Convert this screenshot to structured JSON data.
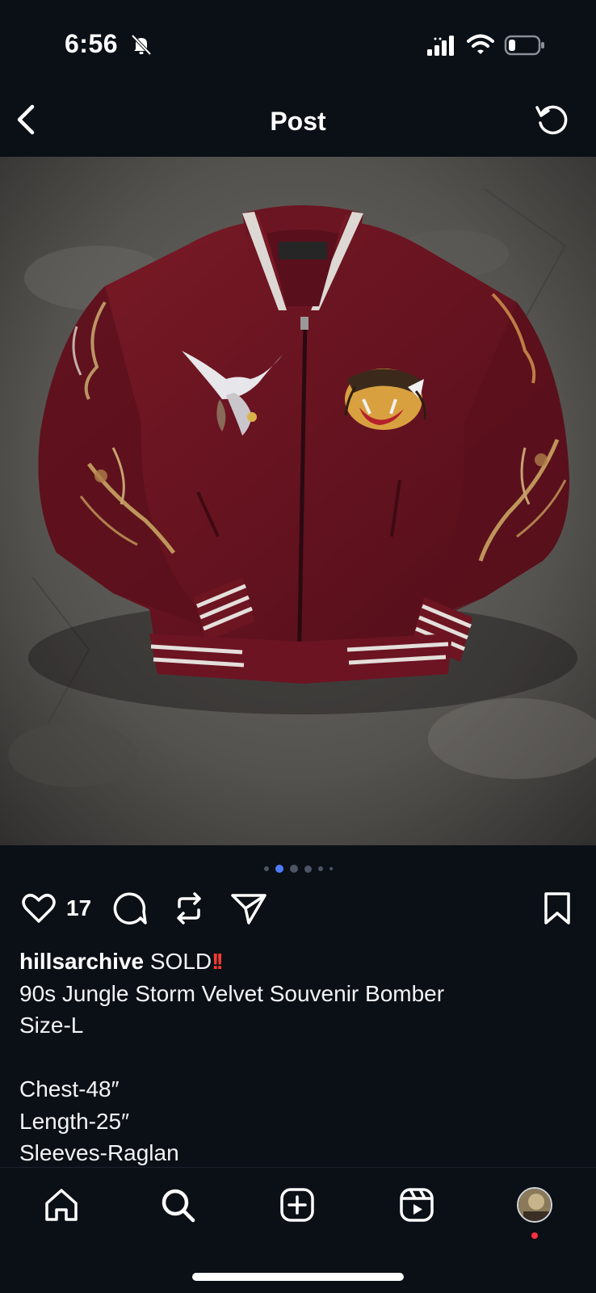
{
  "status_bar": {
    "time": "6:56",
    "icons": [
      "bell-slash-icon",
      "signal-icon",
      "wifi-icon",
      "battery-icon"
    ]
  },
  "header": {
    "title": "Post",
    "back_icon": "chevron-left-icon",
    "refresh_icon": "refresh-icon"
  },
  "post": {
    "image_count": 6,
    "current_image": 2,
    "likes": "17",
    "action_icons": [
      "heart-icon",
      "comment-icon",
      "repost-icon",
      "share-icon",
      "bookmark-icon"
    ],
    "username": "hillsarchive",
    "caption_status": "SOLD",
    "caption_mark": "!!",
    "caption_lines": [
      "90s Jungle Storm Velvet Souvenir Bomber",
      "Size-L",
      "",
      "Chest-48″",
      "Length-25″",
      "Sleeves-Raglan"
    ]
  },
  "bottom_nav": {
    "items": [
      "home-icon",
      "search-icon",
      "create-icon",
      "reels-icon",
      "profile-avatar"
    ]
  },
  "colors": {
    "background": "#0b0f16",
    "text": "#ffffff",
    "accent_dot": "#4f7cff",
    "sold_mark": "#ff3b30",
    "notification": "#ff3040",
    "jacket": "#6b1420"
  }
}
